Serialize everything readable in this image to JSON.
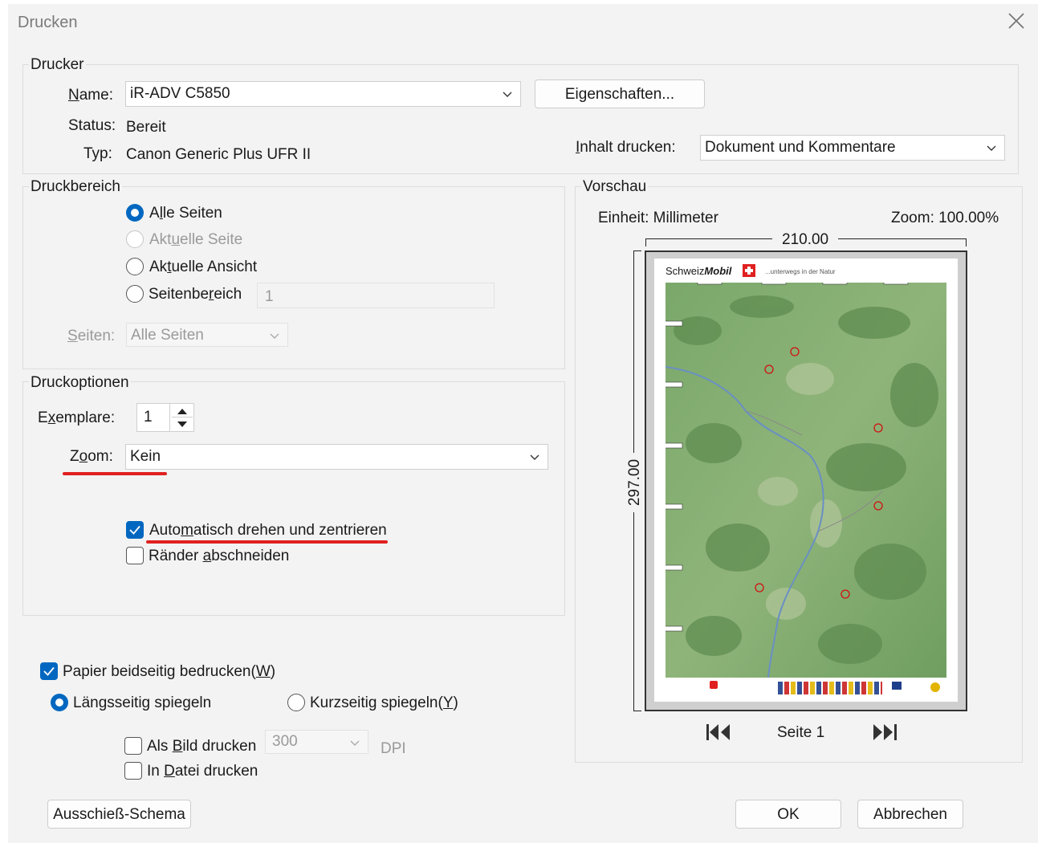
{
  "window": {
    "title": "Drucken"
  },
  "printer": {
    "legend": "Drucker",
    "name_label": "Name:",
    "name_value": "iR-ADV C5850",
    "properties_button": "Eigenschaften...",
    "status_label": "Status:",
    "status_value": "Bereit",
    "type_label": "Typ:",
    "type_value": "Canon Generic Plus UFR II",
    "content_label": "Inhalt drucken:",
    "content_value": "Dokument und Kommentare"
  },
  "print_range": {
    "legend": "Druckbereich",
    "all_pages": "Alle Seiten",
    "current_page": "Aktuelle Seite",
    "current_view": "Aktuelle Ansicht",
    "page_range": "Seitenbereich",
    "page_range_value": "1",
    "pages_label": "Seiten:",
    "pages_value": "Alle Seiten"
  },
  "print_options": {
    "legend": "Druckoptionen",
    "copies_label": "Exemplare:",
    "copies_value": "1",
    "zoom_label": "Zoom:",
    "zoom_value": "Kein",
    "auto_rotate": "Automatisch drehen und zentrieren",
    "crop_margins": "Ränder abschneiden"
  },
  "duplex": {
    "duplex_label": "Papier beidseitig bedrucken(W)",
    "long_edge": "Längsseitig spiegeln",
    "short_edge": "Kurzseitig spiegeln(Y)",
    "as_image": "Als Bild drucken",
    "dpi_value": "300",
    "dpi_label": "DPI",
    "to_file": "In Datei drucken"
  },
  "preview": {
    "legend": "Vorschau",
    "unit": "Einheit: Millimeter",
    "zoom": "Zoom: 100.00%",
    "width": "210.00",
    "height": "297.00",
    "page": "Seite 1",
    "map_brand": "Schweiz",
    "map_brand_bold": "Mobil",
    "map_tagline": "...unterwegs in der Natur"
  },
  "buttons": {
    "imposition": "Ausschieß-Schema",
    "ok": "OK",
    "cancel": "Abbrechen"
  },
  "colors": {
    "accent": "#0067c0",
    "annotation": "#e02020"
  }
}
